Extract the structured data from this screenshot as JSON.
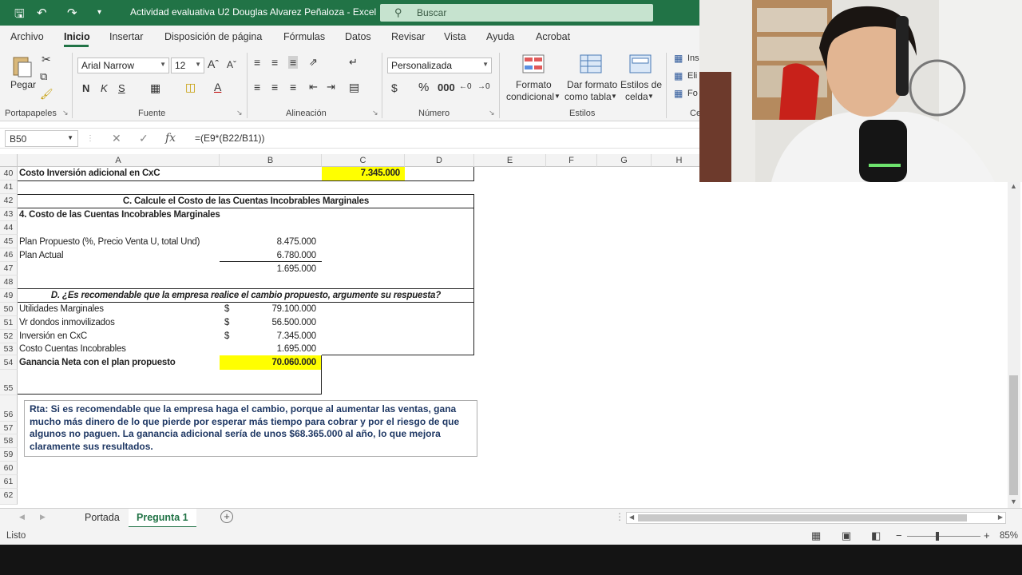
{
  "window": {
    "title": "Actividad evaluativa U2 Douglas Alvarez Peñaloza  -  Excel",
    "search_placeholder": "Buscar"
  },
  "menu": [
    "Archivo",
    "Inicio",
    "Insertar",
    "Disposición de página",
    "Fórmulas",
    "Datos",
    "Revisar",
    "Vista",
    "Ayuda",
    "Acrobat"
  ],
  "ribbon": {
    "paste_label": "Pegar",
    "font_name": "Arial Narrow",
    "font_size": "12",
    "number_format": "Personalizada",
    "cond_format_1": "Formato",
    "cond_format_2": "condicional",
    "table_format_1": "Dar formato",
    "table_format_2": "como tabla",
    "cell_styles_1": "Estilos de",
    "cell_styles_2": "celda",
    "insert_label": "Ins",
    "delete_label": "Eli",
    "format_label": "Fo",
    "groups": {
      "clipboard": "Portapapeles",
      "font": "Fuente",
      "alignment": "Alineación",
      "number": "Número",
      "styles": "Estilos",
      "cells": "Ce"
    }
  },
  "formula_bar": {
    "name_box": "B50",
    "formula": "=(E9*(B22/B11))"
  },
  "columns": [
    "A",
    "B",
    "C",
    "D",
    "E",
    "F",
    "G",
    "H"
  ],
  "rows": [
    "40",
    "41",
    "42",
    "43",
    "44",
    "45",
    "46",
    "47",
    "48",
    "49",
    "50",
    "51",
    "52",
    "53",
    "54",
    "55",
    "56",
    "57",
    "58",
    "59",
    "60",
    "61",
    "62"
  ],
  "cells": {
    "r40_a": "Costo Inversión adicional en CxC",
    "r40_c": "7.345.000",
    "r42_title": "C. Calcule el Costo de las Cuentas Incobrables Marginales",
    "r43_a": "4. Costo de las Cuentas Incobrables Marginales",
    "r45_a": "Plan Propuesto (%, Precio Venta U,  total Und)",
    "r45_b": "8.475.000",
    "r46_a": "Plan Actual",
    "r46_b": "6.780.000",
    "r47_b": "1.695.000",
    "r49_title": "D. ¿Es recomendable que la empresa realice el cambio propuesto, argumente su respuesta?",
    "r50_a": "Utilidades Marginales",
    "r50_cur": "$",
    "r50_b": "79.100.000",
    "r51_a": "Vr dondos inmovilizados",
    "r51_cur": "$",
    "r51_b": "56.500.000",
    "r52_a": "Inversión en CxC",
    "r52_cur": "$",
    "r52_b": "7.345.000",
    "r53_a": "Costo Cuentas Incobrables",
    "r53_b": "1.695.000",
    "r54_a": "Ganancia  Neta con el plan propuesto",
    "r54_b": "70.060.000"
  },
  "note": "Rta: Si es recomendable que la empresa haga el cambio, porque al aumentar las ventas, gana mucho más dinero de lo que pierde por esperar más tiempo para cobrar y por el riesgo de que algunos no paguen. La ganancia adicional sería de unos $68.365.000 al año, lo que mejora claramente sus resultados.",
  "sheets": [
    "Portada",
    "Pregunta 1"
  ],
  "status": {
    "ready": "Listo",
    "zoom": "85%"
  },
  "colors": {
    "excel_green": "#217346",
    "highlight": "#ffff00",
    "note_text": "#1f3864"
  }
}
